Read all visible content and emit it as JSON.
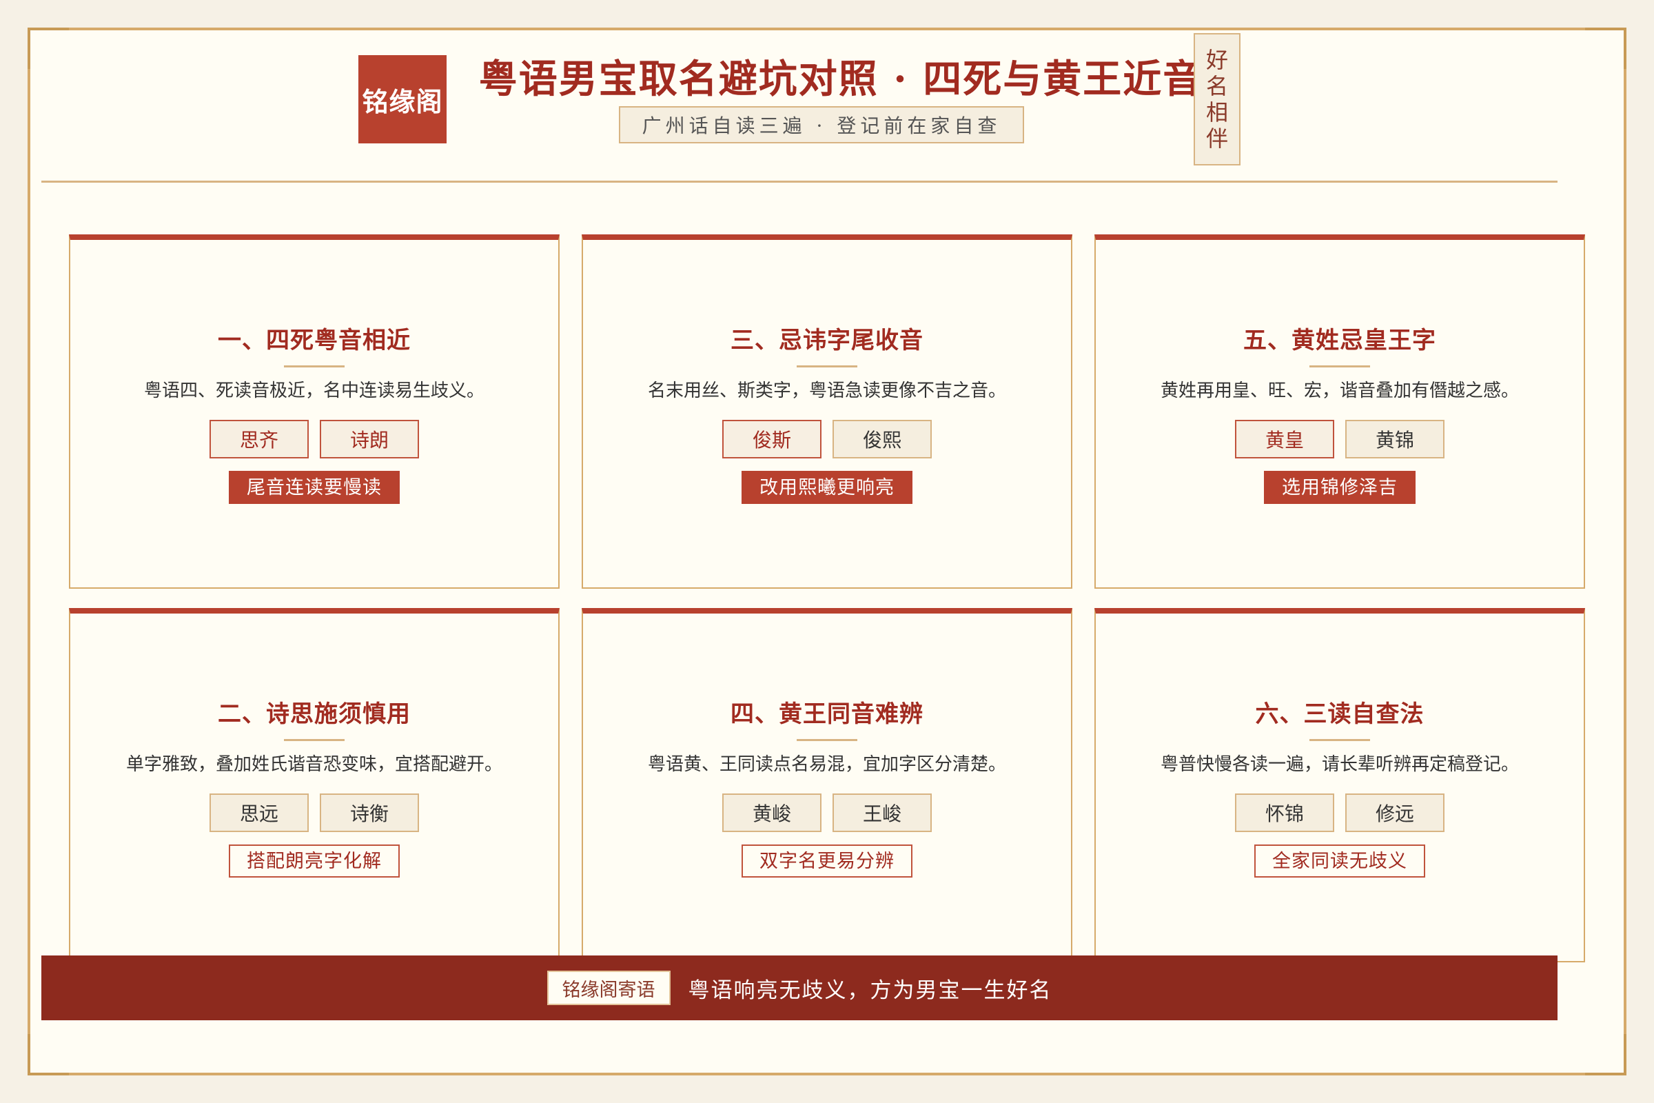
{
  "header": {
    "logo": "铭缘阁",
    "title": "粤语男宝取名避坑对照 · 四死与黄王近音",
    "subtitle": "广州话自读三遍 · 登记前在家自查",
    "stamp": [
      "好",
      "名",
      "相",
      "伴"
    ]
  },
  "cards": [
    {
      "title": "一、四死粤音相近",
      "desc": "粤语四、死读音极近，名中连读易生歧义。",
      "chips": [
        {
          "label": "思齐",
          "style": "red"
        },
        {
          "label": "诗朗",
          "style": "red"
        }
      ],
      "note": "尾音连读要慢读",
      "note_style": "solid"
    },
    {
      "title": "三、忌讳字尾收音",
      "desc": "名末用丝、斯类字，粤语急读更像不吉之音。",
      "chips": [
        {
          "label": "俊斯",
          "style": "red"
        },
        {
          "label": "俊熙",
          "style": "plain"
        }
      ],
      "note": "改用熙曦更响亮",
      "note_style": "solid"
    },
    {
      "title": "五、黄姓忌皇王字",
      "desc": "黄姓再用皇、旺、宏，谐音叠加有僭越之感。",
      "chips": [
        {
          "label": "黄皇",
          "style": "red"
        },
        {
          "label": "黄锦",
          "style": "plain"
        }
      ],
      "note": "选用锦修泽吉",
      "note_style": "solid"
    },
    {
      "title": "二、诗思施须慎用",
      "desc": "单字雅致，叠加姓氏谐音恐变味，宜搭配避开。",
      "chips": [
        {
          "label": "思远",
          "style": "plain"
        },
        {
          "label": "诗衡",
          "style": "plain"
        }
      ],
      "note": "搭配朗亮字化解",
      "note_style": "outline"
    },
    {
      "title": "四、黄王同音难辨",
      "desc": "粤语黄、王同读点名易混，宜加字区分清楚。",
      "chips": [
        {
          "label": "黄峻",
          "style": "plain"
        },
        {
          "label": "王峻",
          "style": "plain"
        }
      ],
      "note": "双字名更易分辨",
      "note_style": "outline"
    },
    {
      "title": "六、三读自查法",
      "desc": "粤普快慢各读一遍，请长辈听辨再定稿登记。",
      "chips": [
        {
          "label": "怀锦",
          "style": "plain"
        },
        {
          "label": "修远",
          "style": "plain"
        }
      ],
      "note": "全家同读无歧义",
      "note_style": "outline"
    }
  ],
  "footer": {
    "tag": "铭缘阁寄语",
    "text": "粤语响亮无歧义，方为男宝一生好名"
  },
  "colors": {
    "accent_red": "#b8412e",
    "dark_red": "#8d2a1e",
    "gold": "#d6aa6a",
    "paper": "#fffdf4"
  }
}
